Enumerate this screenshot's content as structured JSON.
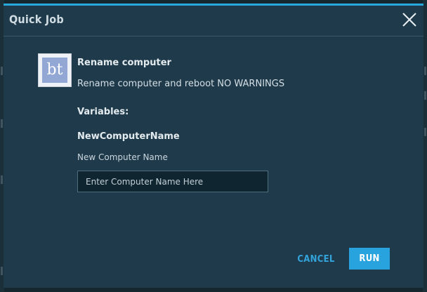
{
  "dialog": {
    "title": "Quick Job",
    "close_icon": "close-icon"
  },
  "job": {
    "logo_text": "bt",
    "name": "Rename computer",
    "description": "Rename computer and reboot NO WARNINGS"
  },
  "variables": {
    "heading": "Variables:",
    "items": [
      {
        "name": "NewComputerName",
        "label": "New Computer Name",
        "value": "",
        "placeholder": "Enter Computer Name Here"
      }
    ]
  },
  "actions": {
    "cancel_label": "CANCEL",
    "run_label": "RUN"
  },
  "colors": {
    "accent": "#29a3de",
    "dialog_bg": "#1f3b4b",
    "input_bg": "#0f2530"
  }
}
